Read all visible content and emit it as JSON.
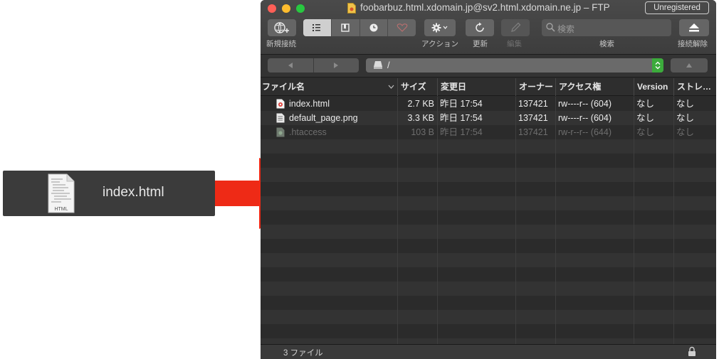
{
  "drag": {
    "file_name": "index.html",
    "icon_caption": "HTML"
  },
  "window": {
    "title": "foobarbuz.html.xdomain.jp@sv2.html.xdomain.ne.jp – FTP",
    "badge": "Unregistered"
  },
  "toolbar": {
    "new_connection": "新規接続",
    "action": "アクション",
    "refresh": "更新",
    "edit": "編集",
    "search_placeholder": "検索",
    "search_label": "検索",
    "disconnect": "接続解除"
  },
  "path": {
    "current": "/"
  },
  "columns": [
    "ファイル名",
    "サイズ",
    "変更日",
    "オーナー",
    "アクセス権",
    "Version",
    "ストレ…"
  ],
  "files": [
    {
      "name": "index.html",
      "size": "2.7 KB",
      "modified": "昨日 17:54",
      "owner": "137421",
      "permissions": "rw----r-- (604)",
      "version": "なし",
      "storage": "なし",
      "icon": "html-file-icon"
    },
    {
      "name": "default_page.png",
      "size": "3.3 KB",
      "modified": "昨日 17:54",
      "owner": "137421",
      "permissions": "rw----r-- (604)",
      "version": "なし",
      "storage": "なし",
      "icon": "image-file-icon"
    },
    {
      "name": ".htaccess",
      "size": "103 B",
      "modified": "昨日 17:54",
      "owner": "137421",
      "permissions": "rw-r--r-- (644)",
      "version": "なし",
      "storage": "なし",
      "icon": "hidden-file-icon"
    }
  ],
  "status": {
    "count": "3 ファイル"
  },
  "colors": {
    "arrow": "#ee2a16",
    "stepper": "#3cab3c"
  }
}
